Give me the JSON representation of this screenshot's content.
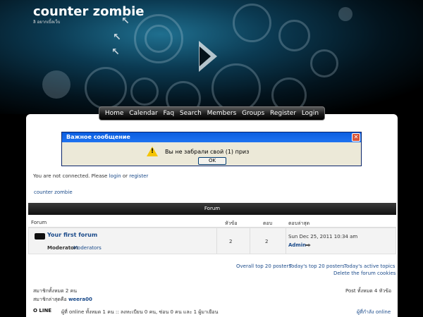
{
  "header": {
    "site_title": "counter zombie",
    "tagline": "ลิ อยากเบิ้ลเว็บ"
  },
  "nav": {
    "items": [
      "Home",
      "Calendar",
      "Faq",
      "Search",
      "Members",
      "Groups",
      "Register",
      "Login"
    ]
  },
  "dialog": {
    "title": "Важное сообщение",
    "message": "Вы не забрали свой (1) приз",
    "ok_label": "OK",
    "close_label": "✕"
  },
  "auth": {
    "prefix": "You are not connected. Please",
    "login": "login",
    "or": "or",
    "register": "register"
  },
  "breadcrumb": "counter zombie",
  "forum_table": {
    "header": "Forum",
    "columns": {
      "forum": "Forum",
      "topics": "หัวข้อ",
      "replies": "ตอบ",
      "last_post": "ตอบล่าสุด"
    },
    "row": {
      "name": "Your first forum",
      "moderator_label": "Moderator:",
      "moderator_value": "Moderators",
      "topics": "2",
      "replies": "2",
      "last_post_date": "Sun Dec 25, 2011 10:34 am",
      "last_post_user": "Admin"
    }
  },
  "links": {
    "overall_top": "Overall top 20 posters",
    "today_top": "Today's top 20 posters",
    "active_topics": "Today's active topics",
    "delete_cookies": "Delete the forum cookies"
  },
  "stats": {
    "members_total": "สมาชิกทั้งหมด 2 คน",
    "newest_label": "สมาชิกล่าสุดคือ",
    "newest_user": "weera00",
    "posts_total": "Post ทั้งหมด 4 หัวข้อ"
  },
  "online": {
    "badge": "O LINE",
    "text": "ผู้ที่ online ทั้งหมด 1 คน :: ลงทะเบียน 0 คน, ซ่อน 0 คน และ 1 ผู้มาเยือน",
    "recent_link": "ผู้ที่กำลัง online"
  },
  "colors": {
    "nav_bg": "#1a1a1a",
    "link": "#1a4a8a",
    "dialog_title_bg": "#0a5de0",
    "warn": "#f5c400"
  }
}
